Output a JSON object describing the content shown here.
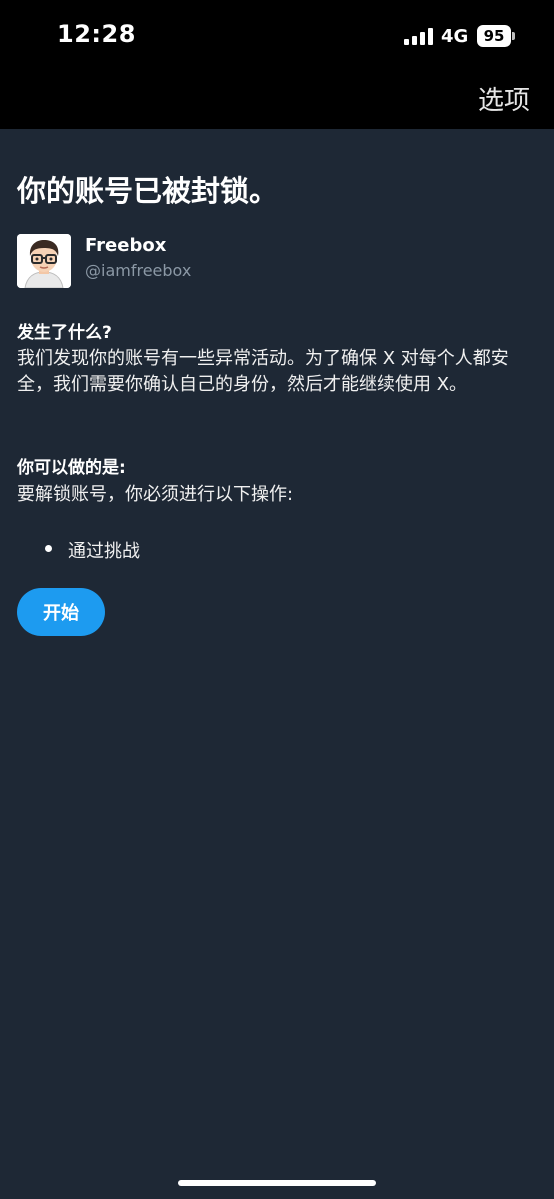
{
  "status_bar": {
    "time": "12:28",
    "network": "4G",
    "battery": "95"
  },
  "header": {
    "options_label": "选项"
  },
  "page": {
    "title": "你的账号已被封锁。"
  },
  "account": {
    "name": "Freebox",
    "handle": "@iamfreebox",
    "avatar_icon": "cartoon-avatar-with-glasses"
  },
  "what_happened": {
    "heading": "发生了什么?",
    "text": "我们发现你的账号有一些异常活动。为了确保 X 对每个人都安全，我们需要你确认自己的身份，然后才能继续使用 X。"
  },
  "what_you_can_do": {
    "heading": "你可以做的是:",
    "text": "要解锁账号，你必须进行以下操作:",
    "items": [
      "通过挑战"
    ]
  },
  "actions": {
    "start_label": "开始"
  },
  "colors": {
    "background": "#1e2835",
    "accent": "#1d9bf0",
    "secondary_text": "#8b98a5"
  }
}
